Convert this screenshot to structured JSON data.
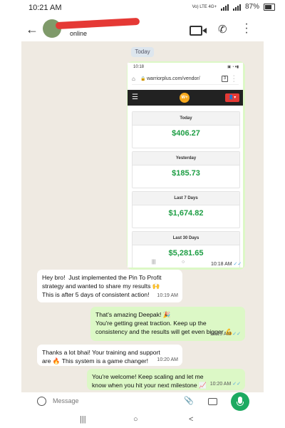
{
  "status_bar": {
    "time": "10:21 AM",
    "network": "Vo) LTE 4G+",
    "battery": "87%"
  },
  "header": {
    "contact_status": "online"
  },
  "chat": {
    "date_chip": "Today",
    "image_message": {
      "time": "10:18 AM",
      "ticks": "✓✓",
      "screenshot": {
        "status_time": "10:18",
        "status_icons": "▣ ◔ ▾▮",
        "url": "warriorplus.com/vendor/",
        "tabs_count": "3",
        "logo": "W+",
        "stats": [
          {
            "label": "Today",
            "value": "$406.27"
          },
          {
            "label": "Yesterday",
            "value": "$185.73"
          },
          {
            "label": "Last 7 Days",
            "value": "$1,674.82"
          },
          {
            "label": "Last 30 Days",
            "value": "$5,281.65"
          }
        ]
      }
    },
    "messages": [
      {
        "direction": "in",
        "text": "Hey bro!  Just implemented the Pin To Profit\nstrategy and wanted to share my results 🙌\nThis is after 5 days of consistent action!",
        "time": "10:19 AM"
      },
      {
        "direction": "out",
        "text": "That's amazing Deepak! 🎉\nYou're getting great traction. Keep up the\nconsistency and the results will get even bigger 💪",
        "time": "10:19 AM",
        "ticks": "✓✓"
      },
      {
        "direction": "in",
        "text": "Thanks a lot bhai! Your training and support\nare 🔥 This system is a game changer!",
        "time": "10:20 AM"
      },
      {
        "direction": "out",
        "text": "You're welcome! Keep scaling and let me\nknow when you hit your next milestone 📈",
        "time": "10:20 AM",
        "ticks": "✓✓"
      }
    ]
  },
  "composer": {
    "placeholder": "Message"
  },
  "system_nav": {
    "recents": "|||",
    "home": "○",
    "back": "<"
  }
}
